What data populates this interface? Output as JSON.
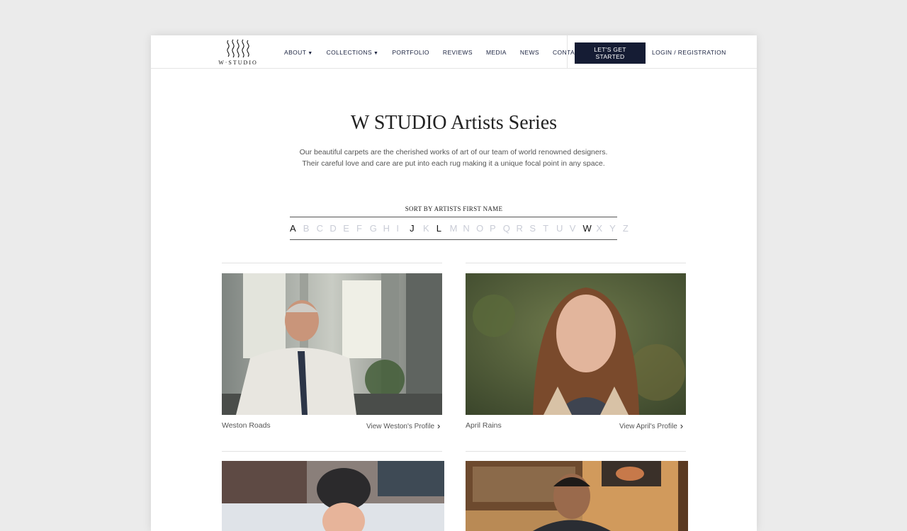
{
  "header": {
    "logo_text": "W·STUDIO",
    "nav": [
      {
        "label": "ABOUT",
        "dropdown": true
      },
      {
        "label": "COLLECTIONS",
        "dropdown": true
      },
      {
        "label": "PORTFOLIO",
        "dropdown": false
      },
      {
        "label": "REVIEWS",
        "dropdown": false
      },
      {
        "label": "MEDIA",
        "dropdown": false
      },
      {
        "label": "NEWS",
        "dropdown": false
      },
      {
        "label": "CONTACT",
        "dropdown": false
      }
    ],
    "cta_label": "LET'S GET STARTED",
    "login_label": "LOGIN / REGISTRATION"
  },
  "hero": {
    "title": "W STUDIO Artists Series",
    "intro": "Our beautiful carpets are the cherished works of art of our team of world renowned designers.  Their careful love and care are put into each rug making it a unique focal point in any space."
  },
  "sort": {
    "label": "SORT BY ARTISTS FIRST NAME",
    "letters": [
      {
        "letter": "A",
        "active": true
      },
      {
        "letter": "B",
        "active": false
      },
      {
        "letter": "C",
        "active": false
      },
      {
        "letter": "D",
        "active": false
      },
      {
        "letter": "E",
        "active": false
      },
      {
        "letter": "F",
        "active": false
      },
      {
        "letter": "G",
        "active": false
      },
      {
        "letter": "H",
        "active": false
      },
      {
        "letter": "I",
        "active": false
      },
      {
        "letter": "J",
        "active": true
      },
      {
        "letter": "K",
        "active": false
      },
      {
        "letter": "L",
        "active": true
      },
      {
        "letter": "M",
        "active": false
      },
      {
        "letter": "N",
        "active": false
      },
      {
        "letter": "O",
        "active": false
      },
      {
        "letter": "P",
        "active": false
      },
      {
        "letter": "Q",
        "active": false
      },
      {
        "letter": "R",
        "active": false
      },
      {
        "letter": "S",
        "active": false
      },
      {
        "letter": "T",
        "active": false
      },
      {
        "letter": "U",
        "active": false
      },
      {
        "letter": "V",
        "active": false
      },
      {
        "letter": "W",
        "active": true
      },
      {
        "letter": "X",
        "active": false
      },
      {
        "letter": "Y",
        "active": false
      },
      {
        "letter": "Z",
        "active": false
      }
    ]
  },
  "artists": [
    {
      "name": "Weston Roads",
      "link": "View Weston's Profile"
    },
    {
      "name": "April Rains",
      "link": "View April's Profile"
    }
  ],
  "colors": {
    "navy": "#151c34",
    "inactive_letter": "#c9ccd6"
  }
}
